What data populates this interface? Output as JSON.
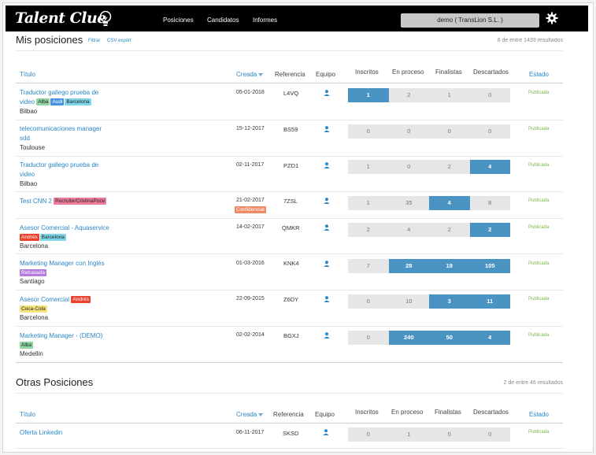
{
  "brand": {
    "name": "Talent Clue"
  },
  "nav": [
    "Posiciones",
    "Candidatos",
    "Informes"
  ],
  "user": {
    "label": "demo ( TransLion S.L. )"
  },
  "mis": {
    "title": "Mis posiciones",
    "filter": "Filtrar",
    "csv": "CSV export",
    "results": "8 de entre 1439 resultados",
    "headers": {
      "titulo": "Título",
      "creada": "Creada",
      "referencia": "Referencia",
      "equipo": "Equipo",
      "inscritos": "Inscritos",
      "proceso": "En proceso",
      "finalistas": "Finalistas",
      "descartados": "Descartados",
      "estado": "Estado"
    },
    "rows": [
      {
        "title1": "Traductor gallego prueba de",
        "title2": "video",
        "tags": [
          "Alba",
          "Audi",
          "Barcelona"
        ],
        "city": "Bilbao",
        "date": "05-01-2018",
        "ref": "L4VQ",
        "vals": [
          "1",
          "2",
          "1",
          "0"
        ],
        "estado": "Publicada"
      },
      {
        "title1": "telecomunicaciones manager",
        "title2": "sdd",
        "tags": [],
        "city": "Toulouse",
        "date": "15-12-2017",
        "ref": "BS59",
        "vals": [
          "0",
          "0",
          "0",
          "0"
        ],
        "estado": "Publicada"
      },
      {
        "title1": "Traductor gallego prueba de",
        "title2": "video",
        "tags": [],
        "city": "Bilbao",
        "date": "02-11-2017",
        "ref": "PZD1",
        "vals": [
          "1",
          "0",
          "2",
          "4"
        ],
        "estado": "Publicada"
      },
      {
        "title1": "Test CNN 2",
        "title2": "",
        "tags": [
          "RecruiterCristinaPoce"
        ],
        "city": "",
        "date": "21-02-2017",
        "datetag": "Confidencial",
        "ref": "7ZSL",
        "vals": [
          "1",
          "35",
          "4",
          "8"
        ],
        "estado": "Publicada"
      },
      {
        "title1": "Asesor Comercial - Aquaservice",
        "title2": "",
        "tags": [
          "Andrés",
          "Barcelona"
        ],
        "city": "Barcelona",
        "date": "14-02-2017",
        "ref": "QMKR",
        "vals": [
          "2",
          "4",
          "2",
          "2"
        ],
        "estado": "Publicada"
      },
      {
        "title1": "Marketing Manager con Inglés",
        "title2": "",
        "tags": [
          "Retrasada"
        ],
        "city": "Santiago",
        "date": "01-03-2016",
        "ref": "KNK4",
        "vals": [
          "7",
          "28",
          "18",
          "105"
        ],
        "estado": "Publicada"
      },
      {
        "title1": "Asesor Comercial",
        "title2": "",
        "tags": [
          "Andrés",
          "Coca-Cola"
        ],
        "city": "Barcelona",
        "date": "22-09-2015",
        "ref": "Z6DY",
        "vals": [
          "0",
          "10",
          "3",
          "11"
        ],
        "estado": "Publicada"
      },
      {
        "title1": "Marketing Manager - (DEMO)",
        "title2": "",
        "tags": [
          "Alba"
        ],
        "city": "Medellin",
        "date": "02-02-2014",
        "ref": "BGXJ",
        "vals": [
          "0",
          "240",
          "50",
          "4"
        ],
        "estado": "Publicada"
      }
    ]
  },
  "otras": {
    "title": "Otras Posiciones",
    "results": "2 de entre 46 resultados",
    "headers": {
      "titulo": "Título",
      "creada": "Creada",
      "referencia": "Referencia",
      "equipo": "Equipo",
      "inscritos": "Inscritos",
      "proceso": "En proceso",
      "finalistas": "Finalistas",
      "descartados": "Descartados",
      "estado": "Estado"
    },
    "rows": [
      {
        "title1": "Oferta Linkedin",
        "date": "06-11-2017",
        "ref": "SKSD",
        "vals": [
          "0",
          "1",
          "0",
          "0"
        ],
        "estado": "Publicada"
      }
    ]
  }
}
